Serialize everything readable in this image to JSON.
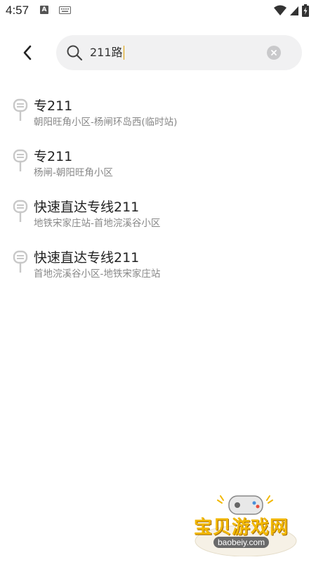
{
  "status_bar": {
    "time": "4:57",
    "app_icon_letter": "A"
  },
  "search": {
    "query": "211路"
  },
  "results": [
    {
      "name": "专211",
      "description": "朝阳旺角小区-杨闸环岛西(临时站)"
    },
    {
      "name": "专211",
      "description": "杨闸-朝阳旺角小区"
    },
    {
      "name": "快速直达专线211",
      "description": "地铁宋家庄站-首地浣溪谷小区"
    },
    {
      "name": "快速直达专线211",
      "description": "首地浣溪谷小区-地铁宋家庄站"
    }
  ],
  "watermark": {
    "title": "宝贝游戏网",
    "url": "baobeiy.com"
  },
  "colors": {
    "search_bg": "#f1f1f2",
    "icon_gray": "#c8c8c8",
    "caret": "#e0a000",
    "watermark_gold": "#f2b800"
  }
}
